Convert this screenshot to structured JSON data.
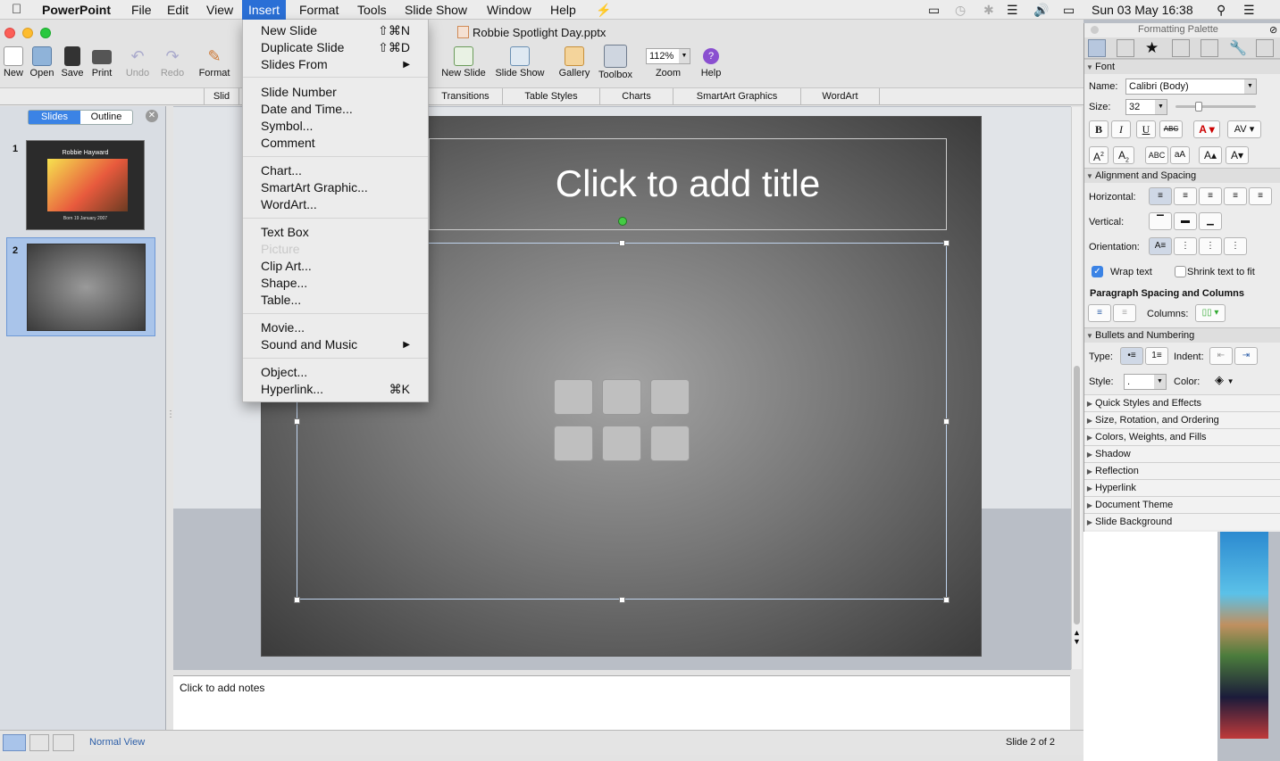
{
  "menubar": {
    "apple": "",
    "app": "PowerPoint",
    "items": [
      "File",
      "Edit",
      "View",
      "Insert",
      "Format",
      "Tools",
      "Slide Show",
      "Window",
      "Help"
    ],
    "clock": "Sun 03 May  16:38"
  },
  "window": {
    "title": "Robbie Spotlight Day.pptx"
  },
  "toolbar": {
    "new": "New",
    "open": "Open",
    "save": "Save",
    "print": "Print",
    "undo": "Undo",
    "redo": "Redo",
    "format": "Format",
    "new_slide": "New Slide",
    "slide_show": "Slide Show",
    "gallery": "Gallery",
    "toolbox": "Toolbox",
    "zoom": "Zoom",
    "zoom_value": "112%",
    "help": "Help"
  },
  "ribbon": {
    "tabs": [
      "Slid",
      "Transitions",
      "Table Styles",
      "Charts",
      "SmartArt Graphics",
      "WordArt"
    ]
  },
  "left_panel": {
    "tab_slides": "Slides",
    "tab_outline": "Outline",
    "thumb1_number": "1",
    "thumb1_title": "Robbie Hayward",
    "thumb1_sub": "Born 19 January 2007",
    "thumb2_number": "2"
  },
  "slide": {
    "title_placeholder": "Click to add title"
  },
  "notes": {
    "placeholder": "Click to add notes"
  },
  "status": {
    "view": "Normal View",
    "position": "Slide 2 of 2"
  },
  "insert_menu": {
    "new_slide": "New Slide",
    "new_slide_sc": "⇧⌘N",
    "duplicate_slide": "Duplicate Slide",
    "duplicate_slide_sc": "⇧⌘D",
    "slides_from": "Slides From",
    "slide_number": "Slide Number",
    "date_time": "Date and Time...",
    "symbol": "Symbol...",
    "comment": "Comment",
    "chart": "Chart...",
    "smartart": "SmartArt Graphic...",
    "wordart": "WordArt...",
    "text_box": "Text Box",
    "picture": "Picture",
    "clip_art": "Clip Art...",
    "shape": "Shape...",
    "table": "Table...",
    "movie": "Movie...",
    "sound_music": "Sound and Music",
    "object": "Object...",
    "hyperlink": "Hyperlink...",
    "hyperlink_sc": "⌘K"
  },
  "palette": {
    "title": "Formatting Palette",
    "font_section": "Font",
    "name_label": "Name:",
    "font_name": "Calibri (Body)",
    "size_label": "Size:",
    "font_size": "32",
    "align_section": "Alignment and Spacing",
    "horizontal_label": "Horizontal:",
    "vertical_label": "Vertical:",
    "orientation_label": "Orientation:",
    "wrap_text": "Wrap text",
    "shrink_text": "Shrink text to fit",
    "para_spacing": "Paragraph Spacing and Columns",
    "columns_label": "Columns:",
    "bullets_section": "Bullets and Numbering",
    "type_label": "Type:",
    "indent_label": "Indent:",
    "style_label": "Style:",
    "color_label": "Color:",
    "collapsed": [
      "Quick Styles and Effects",
      "Size, Rotation, and Ordering",
      "Colors, Weights, and Fills",
      "Shadow",
      "Reflection",
      "Hyperlink",
      "Document Theme",
      "Slide Background"
    ]
  },
  "colors": {
    "accent": "#2a6fd6",
    "selection": "#a9c4ea"
  }
}
